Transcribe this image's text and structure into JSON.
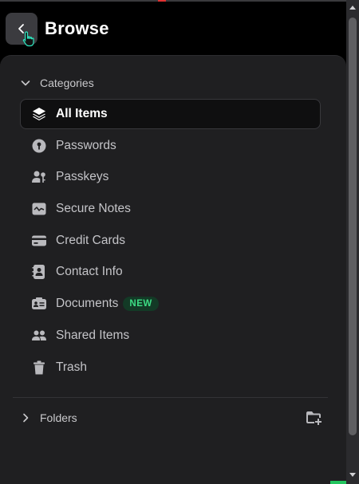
{
  "header": {
    "title": "Browse"
  },
  "sections": {
    "categories_label": "Categories",
    "folders_label": "Folders"
  },
  "items": [
    {
      "label": "All Items",
      "icon": "layers-icon",
      "active": true
    },
    {
      "label": "Passwords",
      "icon": "key-circle-icon"
    },
    {
      "label": "Passkeys",
      "icon": "passkey-icon"
    },
    {
      "label": "Secure Notes",
      "icon": "note-icon"
    },
    {
      "label": "Credit Cards",
      "icon": "credit-card-icon"
    },
    {
      "label": "Contact Info",
      "icon": "contact-book-icon"
    },
    {
      "label": "Documents",
      "icon": "document-id-icon",
      "badge": "NEW"
    },
    {
      "label": "Shared Items",
      "icon": "people-icon"
    },
    {
      "label": "Trash",
      "icon": "trash-icon"
    }
  ],
  "colors": {
    "accent": "#3ddc84",
    "panel": "#1f1f21",
    "active_bg": "#0f0f10"
  }
}
